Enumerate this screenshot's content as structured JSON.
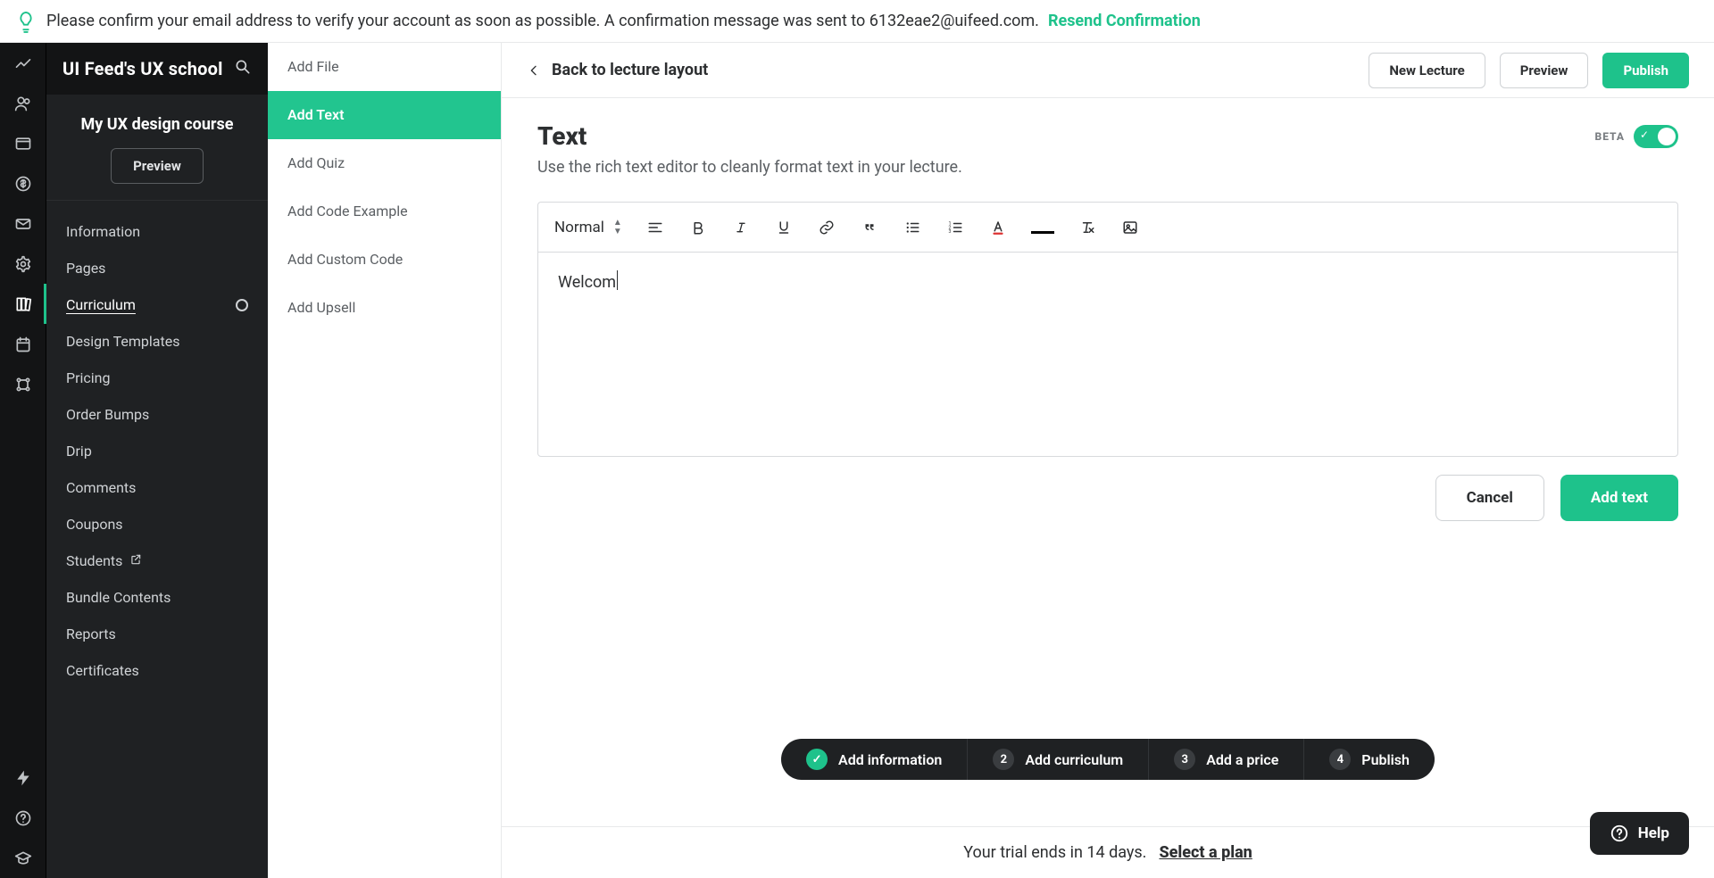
{
  "banner": {
    "text": "Please confirm your email address to verify your account as soon as possible. A confirmation message was sent to 6132eae2@uifeed.com.",
    "resend": "Resend Confirmation"
  },
  "brand": {
    "title": "UI Feed's UX school"
  },
  "course": {
    "name": "My UX design course",
    "preview": "Preview"
  },
  "sidenav": {
    "items": [
      {
        "label": "Information"
      },
      {
        "label": "Pages"
      },
      {
        "label": "Curriculum",
        "active": true
      },
      {
        "label": "Design Templates"
      },
      {
        "label": "Pricing"
      },
      {
        "label": "Order Bumps"
      },
      {
        "label": "Drip"
      },
      {
        "label": "Comments"
      },
      {
        "label": "Coupons"
      },
      {
        "label": "Students",
        "external": true
      },
      {
        "label": "Bundle Contents"
      },
      {
        "label": "Reports"
      },
      {
        "label": "Certificates"
      }
    ]
  },
  "types": {
    "items": [
      {
        "label": "Add File"
      },
      {
        "label": "Add Text",
        "active": true
      },
      {
        "label": "Add Quiz"
      },
      {
        "label": "Add Code Example"
      },
      {
        "label": "Add Custom Code"
      },
      {
        "label": "Add Upsell"
      }
    ]
  },
  "toolbar": {
    "back": "Back to lecture layout",
    "new_lecture": "New Lecture",
    "preview": "Preview",
    "publish": "Publish"
  },
  "section": {
    "title": "Text",
    "subtitle": "Use the rich text editor to cleanly format text in your lecture.",
    "beta": "BETA"
  },
  "editor": {
    "format_label": "Normal",
    "body": "Welcom"
  },
  "actions": {
    "cancel": "Cancel",
    "add_text": "Add text"
  },
  "steps": [
    {
      "label": "Add information",
      "done": true
    },
    {
      "label": "Add curriculum",
      "num": "2"
    },
    {
      "label": "Add a price",
      "num": "3"
    },
    {
      "label": "Publish",
      "num": "4"
    }
  ],
  "trial": {
    "text": "Your trial ends in 14 days.",
    "cta": "Select a plan"
  },
  "help": {
    "label": "Help"
  }
}
